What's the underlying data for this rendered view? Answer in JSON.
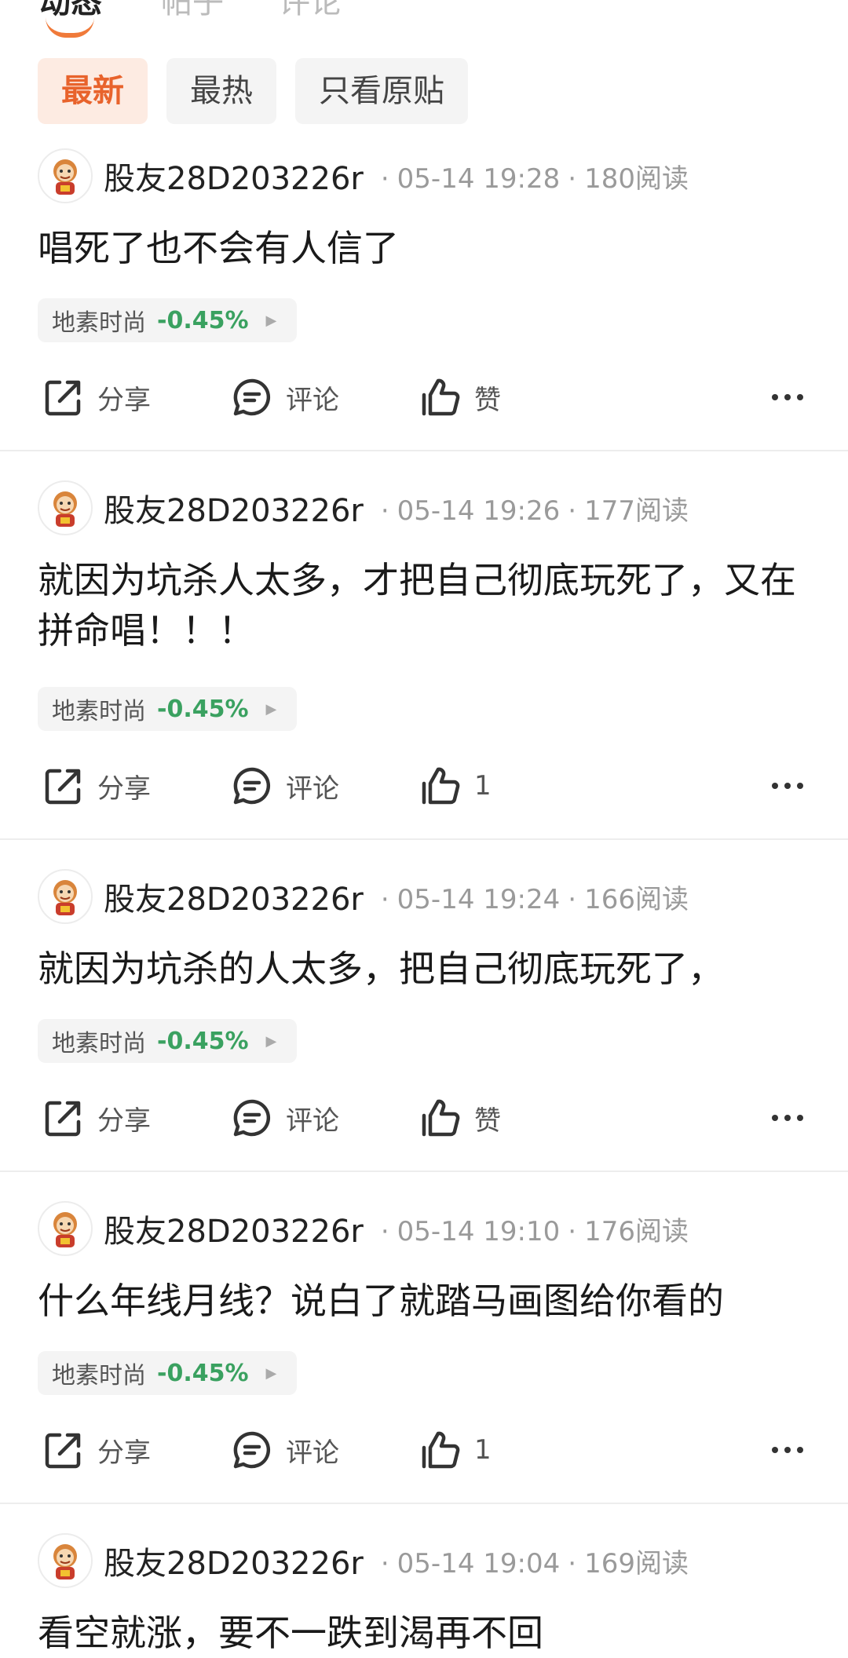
{
  "top_tabs": [
    "动态",
    "帖子",
    "评论"
  ],
  "filters": [
    "最新",
    "最热",
    "只看原贴"
  ],
  "posts": [
    {
      "username": "股友28D203226r",
      "time": "05-14 19:28",
      "reads": "180阅读",
      "content": "唱死了也不会有人信了",
      "stock_name": "地素时尚",
      "stock_change": "-0.45%",
      "share": "分享",
      "comment": "评论",
      "like": "赞"
    },
    {
      "username": "股友28D203226r",
      "time": "05-14 19:26",
      "reads": "177阅读",
      "content": "就因为坑杀人太多，才把自己彻底玩死了，又在拼命唱！！！",
      "stock_name": "地素时尚",
      "stock_change": "-0.45%",
      "share": "分享",
      "comment": "评论",
      "like": "1"
    },
    {
      "username": "股友28D203226r",
      "time": "05-14 19:24",
      "reads": "166阅读",
      "content": "就因为坑杀的人太多，把自己彻底玩死了，",
      "stock_name": "地素时尚",
      "stock_change": "-0.45%",
      "share": "分享",
      "comment": "评论",
      "like": "赞"
    },
    {
      "username": "股友28D203226r",
      "time": "05-14 19:10",
      "reads": "176阅读",
      "content": "什么年线月线？说白了就踏马画图给你看的",
      "stock_name": "地素时尚",
      "stock_change": "-0.45%",
      "share": "分享",
      "comment": "评论",
      "like": "1"
    },
    {
      "username": "股友28D203226r",
      "time": "05-14 19:04",
      "reads": "169阅读",
      "content": "看空就涨，要不一跌到渴再不回"
    }
  ],
  "colors": {
    "accent": "#e8632c",
    "accent_bg": "#fdebe2",
    "stock_down": "#3aa160",
    "divider": "#ededed"
  }
}
